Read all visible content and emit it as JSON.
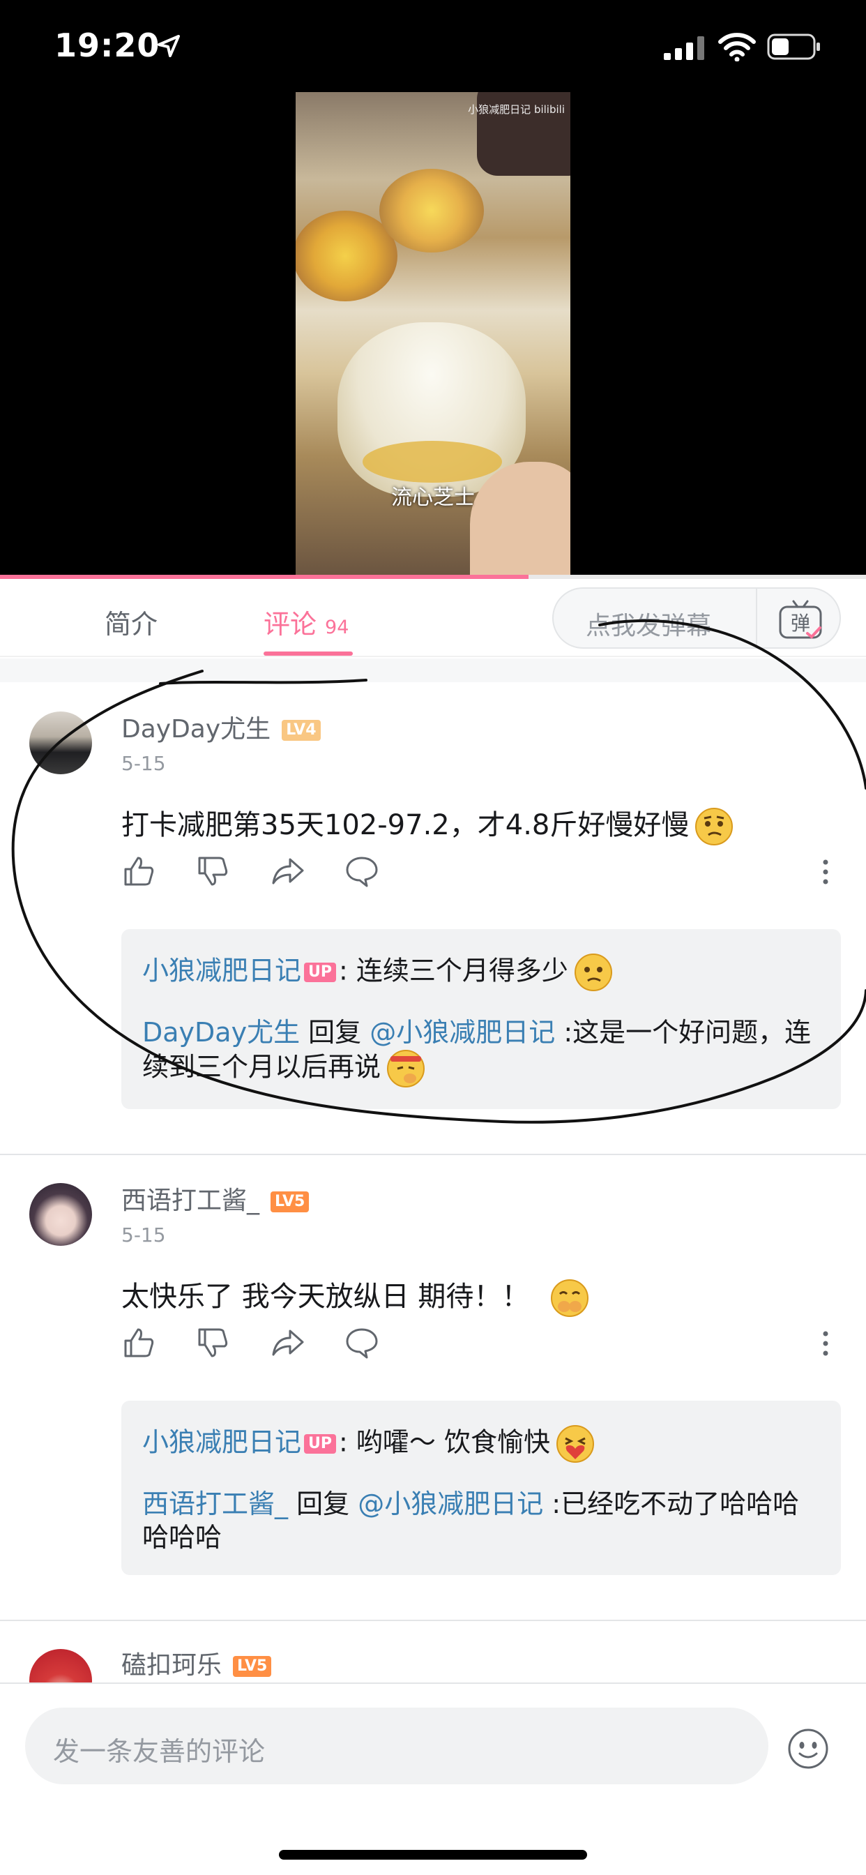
{
  "status_bar": {
    "time": "19:20"
  },
  "video": {
    "watermark": "小狼减肥日记 bilibili",
    "subtitle": "流心芝士",
    "progress": 0.61
  },
  "tabs": {
    "intro_label": "简介",
    "comments_label": "评论",
    "comments_count": "94",
    "danmaku_placeholder": "点我发弹幕",
    "danmaku_button": "弹"
  },
  "comments": [
    {
      "username": "DayDay尤生",
      "level": "LV4",
      "date": "5-15",
      "text": "打卡减肥第35天102-97.2，才4.8斤好慢好慢",
      "replies": [
        {
          "name": "小狼减肥日记",
          "badge": "UP",
          "sep": ":",
          "text": " 连续三个月得多少"
        },
        {
          "name": "DayDay尤生",
          "reply_word": " 回复 ",
          "mention": "@小狼减肥日记",
          "text": " :这是一个好问题，连续到三个月以后再说"
        }
      ]
    },
    {
      "username": "西语打工酱_",
      "level": "LV5",
      "date": "5-15",
      "text": "太快乐了 我今天放纵日 期待！！",
      "replies": [
        {
          "name": "小狼减肥日记",
          "badge": "UP",
          "sep": ":",
          "text": " 哟嚯～ 饮食愉快"
        },
        {
          "name": "西语打工酱_",
          "reply_word": " 回复 ",
          "mention": "@小狼减肥日记",
          "text": " :已经吃不动了哈哈哈哈哈哈"
        }
      ]
    },
    {
      "username": "磕扣珂乐",
      "level": "LV5"
    }
  ],
  "bottom_bar": {
    "placeholder": "发一条友善的评论"
  },
  "colors": {
    "accent": "#fb7299",
    "link": "#3a7fb3",
    "text": "#18191c",
    "muted": "#9499a0"
  }
}
